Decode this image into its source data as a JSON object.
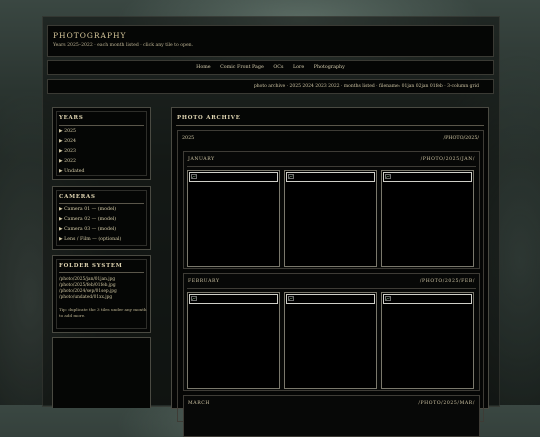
{
  "header": {
    "title": "PHOTOGRAPHY",
    "tagline": "Years 2025–2022 · each month listed · click any tile to open."
  },
  "nav": {
    "items": [
      "Home",
      "Comic Front Page",
      "OCs",
      "Lore",
      "Photography"
    ]
  },
  "breadcrumb": "photo archive · 2025 2024 2023 2022 · months listed · filename: 01jan 02jan 01feb · 3-column grid",
  "sidebar": {
    "years": {
      "title": "YEARS",
      "items": [
        "▶ 2025",
        "▶ 2024",
        "▶ 2023",
        "▶ 2022",
        "▶ Undated"
      ]
    },
    "cameras": {
      "title": "CAMERAS",
      "items": [
        "▶ Camera 01 — (model)",
        "▶ Camera 02 — (model)",
        "▶ Camera 03 — (model)",
        "▶ Lens / Film — (optional)"
      ]
    },
    "folder": {
      "title": "FOLDER SYSTEM",
      "paths": [
        "/photo/2025/jan/01jan.jpg",
        "/photo/2025/feb/01feb.jpg",
        "/photo/2024/sep/01sep.jpg",
        "/photo/undated/01xx.jpg"
      ],
      "tip": "Tip: duplicate the 3 tiles under any month to add more."
    }
  },
  "main": {
    "title": "PHOTO ARCHIVE",
    "year": "2025",
    "year_path": "/PHOTO/2025/",
    "months": [
      {
        "name": "JANUARY",
        "path": "/PHOTO/2025/JAN/"
      },
      {
        "name": "FEBRUARY",
        "path": "/PHOTO/2025/FEB/"
      },
      {
        "name": "MARCH",
        "path": "/PHOTO/2025/MAR/"
      }
    ]
  },
  "colors": {
    "accent": "#d8c89c",
    "panel": "#050605",
    "border": "#4a4a42"
  }
}
